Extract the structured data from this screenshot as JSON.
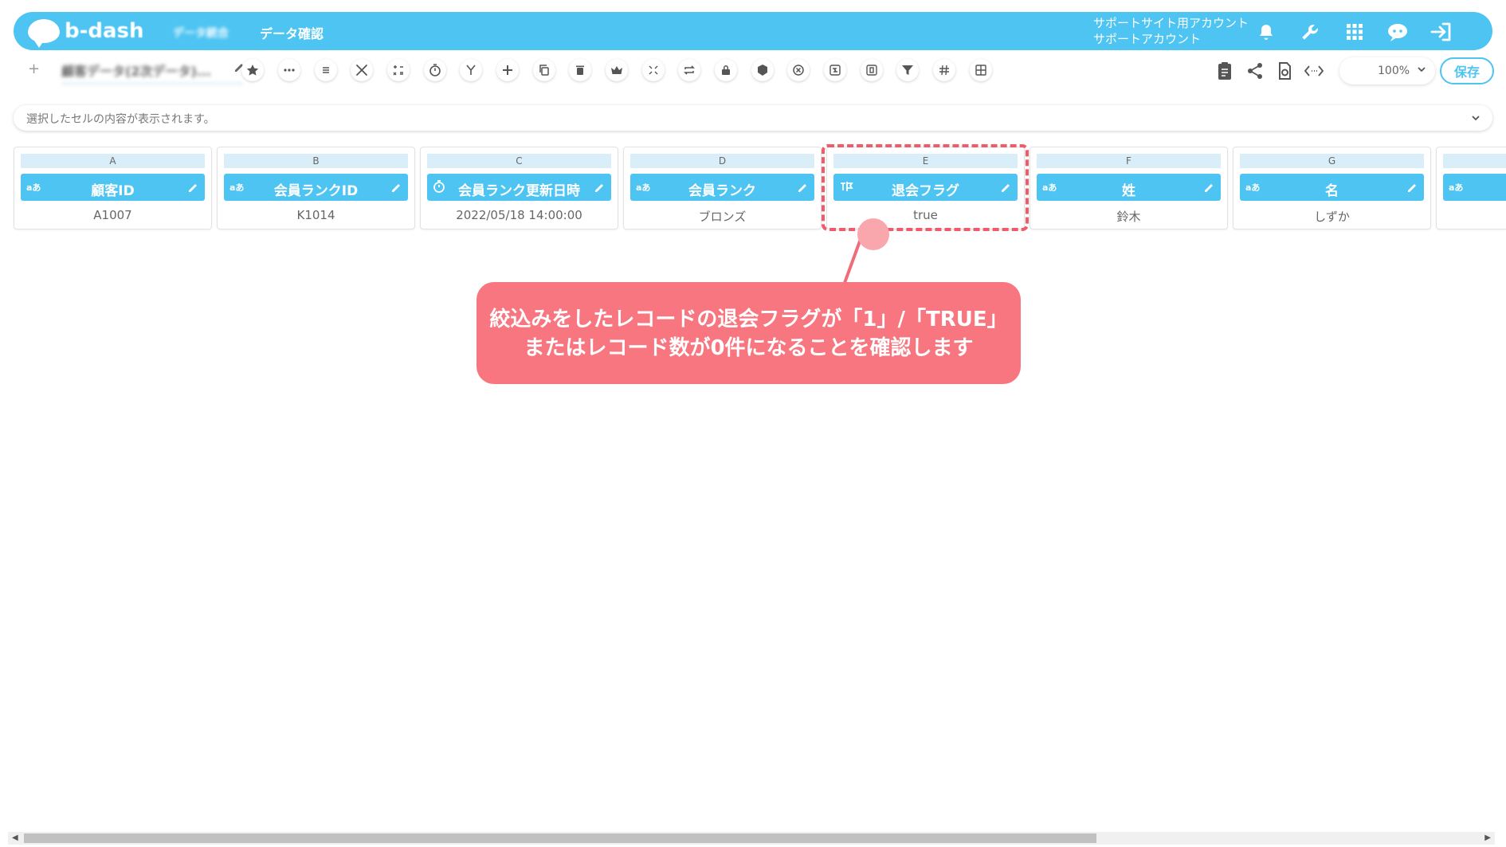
{
  "header": {
    "logo_text": "b-dash",
    "nav_blurred": "データ統合",
    "title": "データ確認",
    "account_line1": "サポートサイト用アカウント",
    "account_line2": "サポートアカウント",
    "icons": [
      "bell-icon",
      "wrench-icon",
      "grid-apps-icon",
      "chat-bot-icon",
      "logout-icon"
    ]
  },
  "toolbar": {
    "back_symbol": "+",
    "data_name": "顧客データ(2次データ)...",
    "tools": [
      "star-icon",
      "more-icon",
      "list-icon",
      "tools-icon",
      "calc-icon",
      "timer-icon",
      "merge-icon",
      "add-icon",
      "copy-icon",
      "trash-icon",
      "crown-icon",
      "expand-icon",
      "repeat-icon",
      "lock-icon",
      "box-icon",
      "cancel-icon",
      "transform-icon",
      "frame-icon",
      "filter-icon",
      "hash-icon",
      "table-icon"
    ],
    "right_icons": [
      "clipboard-icon",
      "share-icon",
      "refresh-doc-icon",
      "code-icon"
    ],
    "zoom": "100%",
    "save_label": "保存"
  },
  "cell_bar": {
    "placeholder": "選択したセルの内容が表示されます。"
  },
  "columns": [
    {
      "letter": "A",
      "type": "aあ",
      "name": "顧客ID",
      "value": "A1007"
    },
    {
      "letter": "B",
      "type": "aあ",
      "name": "会員ランクID",
      "value": "K1014"
    },
    {
      "letter": "C",
      "type": "clock",
      "name": "会員ランク更新日時",
      "value": "2022/05/18 14:00:00"
    },
    {
      "letter": "D",
      "type": "aあ",
      "name": "会員ランク",
      "value": "ブロンズ"
    },
    {
      "letter": "E",
      "type": "flag",
      "name": "退会フラグ",
      "value": "true"
    },
    {
      "letter": "F",
      "type": "aあ",
      "name": "姓",
      "value": "鈴木"
    },
    {
      "letter": "G",
      "type": "aあ",
      "name": "名",
      "value": "しずか"
    },
    {
      "letter": "",
      "type": "aあ",
      "name": "",
      "value": ""
    }
  ],
  "callout": {
    "line1": "絞込みをしたレコードの退会フラグが「1」/「TRUE」",
    "line2": "またはレコード数が0件になることを確認します"
  },
  "colors": {
    "brand": "#4dc4f2",
    "callout": "#f7767f",
    "highlight": "#f05a6a"
  }
}
